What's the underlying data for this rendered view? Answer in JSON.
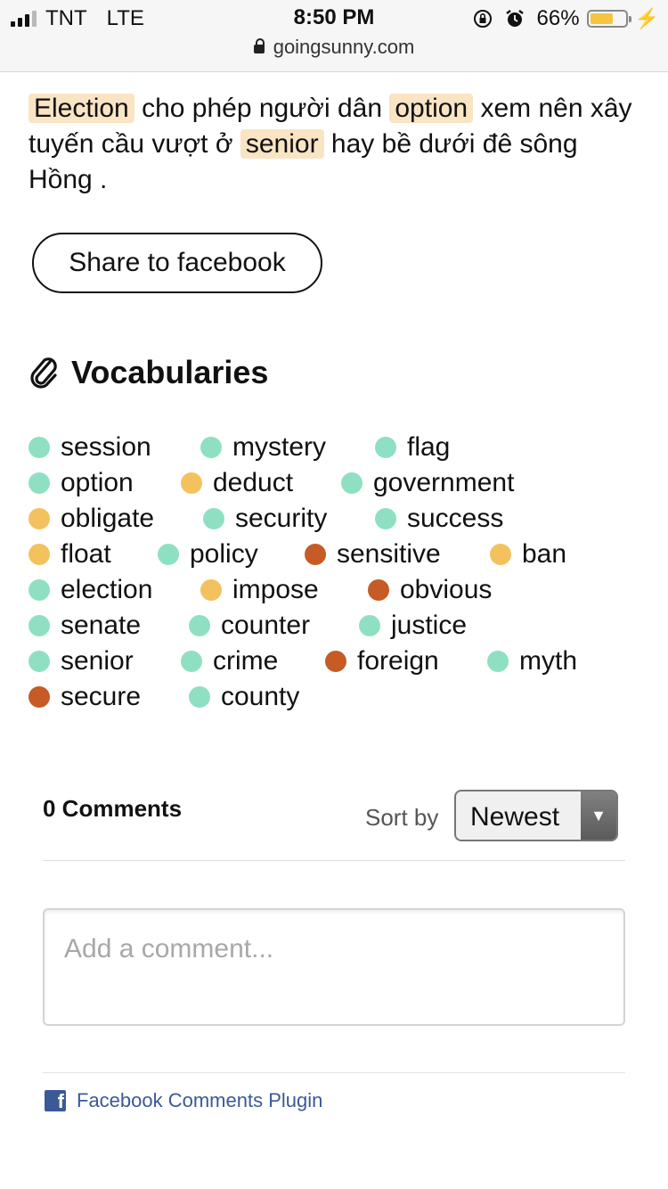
{
  "status_bar": {
    "carrier": "TNT",
    "network": "LTE",
    "time": "8:50 PM",
    "battery_percent": "66%",
    "battery_level": 0.66,
    "url": "goingsunny.com"
  },
  "article": {
    "segments": [
      {
        "text": "Election",
        "highlight": true
      },
      {
        "text": " cho phép người dân ",
        "highlight": false
      },
      {
        "text": "option",
        "highlight": true
      },
      {
        "text": " xem nên xây tuyến cầu vượt ở ",
        "highlight": false
      },
      {
        "text": "senior",
        "highlight": true
      },
      {
        "text": " hay bề dưới đê sông Hồng .",
        "highlight": false
      }
    ]
  },
  "share_button": {
    "label": "Share to facebook"
  },
  "vocabularies": {
    "title": "Vocabularies",
    "colors": {
      "green": "#8fe0c2",
      "yellow": "#f3c25f",
      "red": "#c65b26"
    },
    "rows": [
      [
        {
          "word": "session",
          "level": "green"
        },
        {
          "word": "mystery",
          "level": "green"
        },
        {
          "word": "flag",
          "level": "green"
        }
      ],
      [
        {
          "word": "option",
          "level": "green"
        },
        {
          "word": "deduct",
          "level": "yellow"
        },
        {
          "word": "government",
          "level": "green"
        }
      ],
      [
        {
          "word": "obligate",
          "level": "yellow"
        },
        {
          "word": "security",
          "level": "green"
        },
        {
          "word": "success",
          "level": "green"
        }
      ],
      [
        {
          "word": "float",
          "level": "yellow"
        },
        {
          "word": "policy",
          "level": "green"
        },
        {
          "word": "sensitive",
          "level": "red"
        },
        {
          "word": "ban",
          "level": "yellow"
        }
      ],
      [
        {
          "word": "election",
          "level": "green"
        },
        {
          "word": "impose",
          "level": "yellow"
        },
        {
          "word": "obvious",
          "level": "red"
        }
      ],
      [
        {
          "word": "senate",
          "level": "green"
        },
        {
          "word": "counter",
          "level": "green"
        },
        {
          "word": "justice",
          "level": "green"
        }
      ],
      [
        {
          "word": "senior",
          "level": "green"
        },
        {
          "word": "crime",
          "level": "green"
        },
        {
          "word": "foreign",
          "level": "red"
        },
        {
          "word": "myth",
          "level": "green"
        }
      ],
      [
        {
          "word": "secure",
          "level": "red"
        },
        {
          "word": "county",
          "level": "green"
        }
      ]
    ]
  },
  "comments": {
    "count_label": "0 Comments",
    "sort_label": "Sort by",
    "sort_value": "Newest",
    "input_placeholder": "Add a comment...",
    "plugin_label": "Facebook Comments Plugin"
  }
}
